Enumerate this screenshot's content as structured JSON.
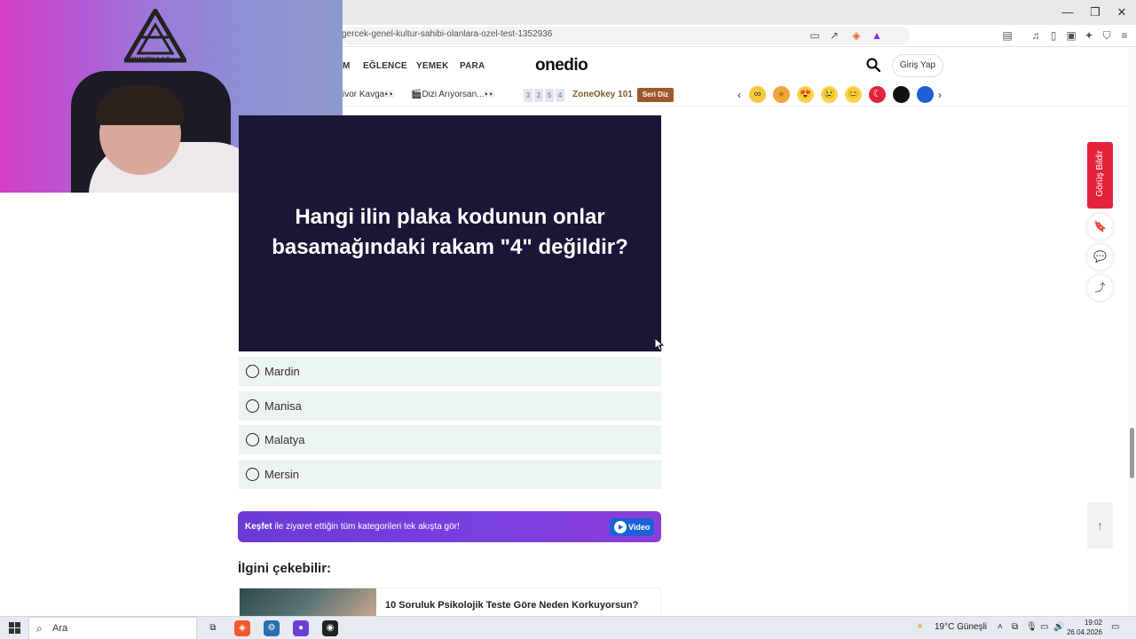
{
  "browser": {
    "url": "gercek-genel-kultur-sahibi-olanlara-ozel-test-1352936",
    "window_controls": [
      "—",
      "❐",
      "✕"
    ]
  },
  "header": {
    "nav": [
      "M",
      "EĞLENCE",
      "YEMEK",
      "PARA"
    ],
    "logo": "onedio",
    "login_label": "Giriş Yap"
  },
  "subnav": {
    "items": [
      "ivor Kavga👀",
      "🎬Dizi Arıyorsan...👀"
    ],
    "zone_numbers": [
      "3",
      "2",
      "5",
      "4"
    ],
    "zone_label": "ZoneOkey 101",
    "seri_diz": "Seri Diz",
    "emojis": [
      "∞",
      "●",
      "😍",
      "😢",
      "😊",
      "☾",
      "●",
      "●"
    ]
  },
  "webcam": {
    "logo_text": "AYKUTKAAS"
  },
  "question": {
    "text": "Hangi ilin plaka kodunun onlar basamağındaki rakam \"4\" değildir?",
    "options": [
      "Mardin",
      "Manisa",
      "Malatya",
      "Mersin"
    ]
  },
  "kesfet": {
    "bold": "Keşfet",
    "text": " ile ziyaret ettiğin tüm kategorileri tek akışta gör!",
    "video_label": "Video"
  },
  "recommend": {
    "heading": "İlgini çekebilir:",
    "item_title": "10 Soruluk Psikolojik Teste Göre Neden Korkuyorsun?"
  },
  "side": {
    "feedback": "Görüş Bildir"
  },
  "taskbar": {
    "search_label": "Ara",
    "weather": "19°C  Güneşli",
    "time": "19:02",
    "date": "26.04.2026"
  }
}
